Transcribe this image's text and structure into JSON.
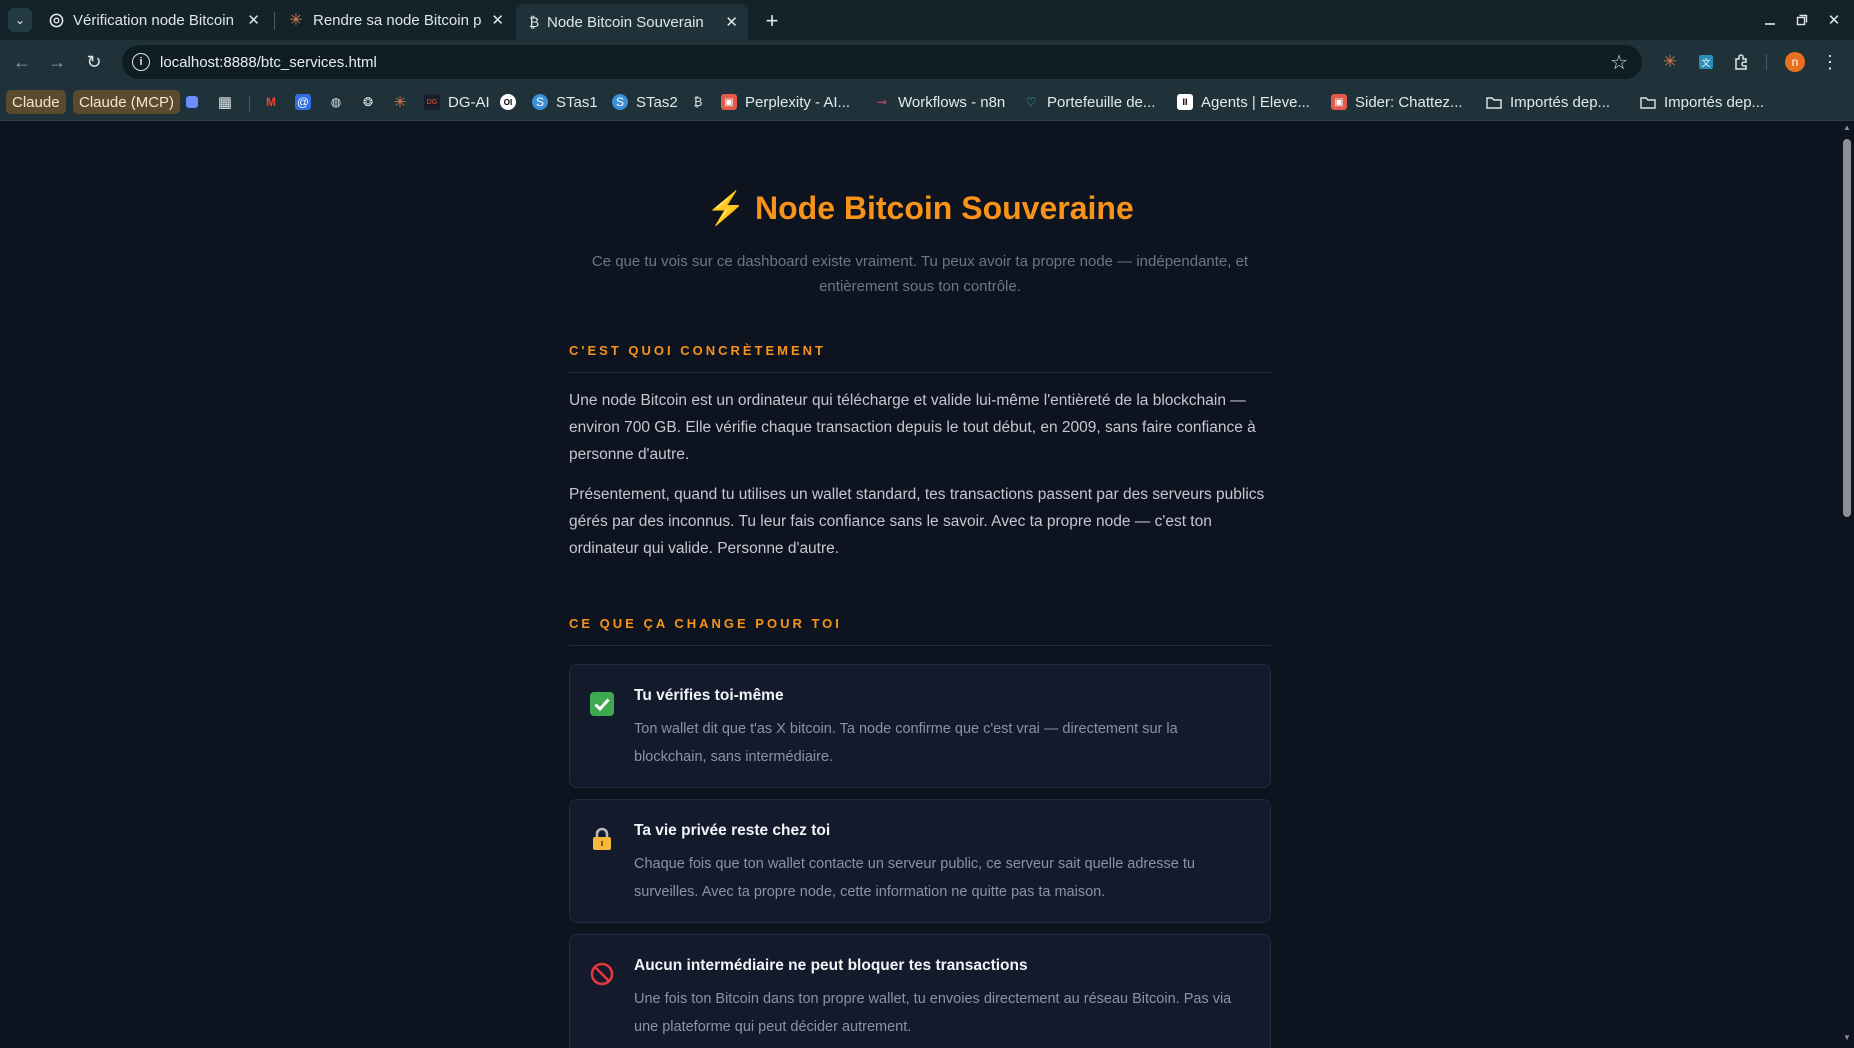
{
  "browser": {
    "tabs": [
      {
        "title": "Vérification node Bitcoin",
        "favicon": "openai-icon"
      },
      {
        "title": "Rendre sa node Bitcoin p",
        "favicon": "claude-icon"
      },
      {
        "title": "Node Bitcoin Souverain",
        "favicon": "bitcoin-icon"
      }
    ],
    "url": "localhost:8888/btc_services.html",
    "profile_initial": "n",
    "bookmarks": [
      {
        "label": "Claude"
      },
      {
        "label": "Claude (MCP)"
      },
      {
        "label": "DG-AI"
      },
      {
        "label": "STas1"
      },
      {
        "label": "STas2"
      },
      {
        "label": "Perplexity - AI..."
      },
      {
        "label": "Workflows - n8n"
      },
      {
        "label": "Portefeuille de..."
      },
      {
        "label": "Agents | Eleve..."
      },
      {
        "label": "Sider: Chattez..."
      },
      {
        "label": "Importés dep..."
      },
      {
        "label": "Importés dep..."
      }
    ]
  },
  "page": {
    "title": "Node Bitcoin Souveraine",
    "title_icon": "⚡",
    "subtitle": "Ce que tu vois sur ce dashboard existe vraiment. Tu peux avoir ta propre node — indépendante, et entièrement sous ton contrôle.",
    "section1": {
      "heading": "C'est quoi concrètement",
      "paragraphs": [
        "Une node Bitcoin est un ordinateur qui télécharge et valide lui-même l'entièreté de la blockchain — environ 700 GB. Elle vérifie chaque transaction depuis le tout début, en 2009, sans faire confiance à personne d'autre.",
        "Présentement, quand tu utilises un wallet standard, tes transactions passent par des serveurs publics gérés par des inconnus. Tu leur fais confiance sans le savoir. Avec ta propre node — c'est ton ordinateur qui valide. Personne d'autre."
      ]
    },
    "section2": {
      "heading": "Ce que ça change pour toi",
      "cards": [
        {
          "icon": "check-icon",
          "title": "Tu vérifies toi-même",
          "desc": "Ton wallet dit que t'as X bitcoin. Ta node confirme que c'est vrai — directement sur la blockchain, sans intermédiaire."
        },
        {
          "icon": "lock-icon",
          "title": "Ta vie privée reste chez toi",
          "desc": "Chaque fois que ton wallet contacte un serveur public, ce serveur sait quelle adresse tu surveilles. Avec ta propre node, cette information ne quitte pas ta maison."
        },
        {
          "icon": "prohibited-icon",
          "title": "Aucun intermédiaire ne peut bloquer tes transactions",
          "desc": "Une fois ton Bitcoin dans ton propre wallet, tu envoies directement au réseau Bitcoin. Pas via une plateforme qui peut décider autrement."
        }
      ]
    }
  },
  "colors": {
    "accent": "#f7931a",
    "background": "#0e1320",
    "card": "#131a2c"
  }
}
